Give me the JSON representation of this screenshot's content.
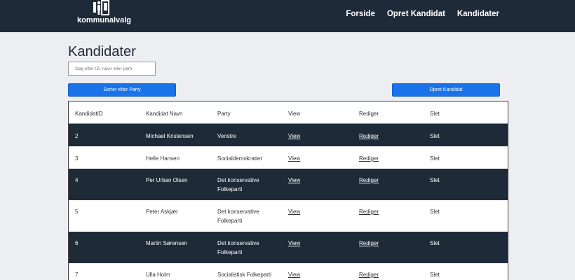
{
  "nav": {
    "logo_text": "kommunalvalg",
    "links": [
      "Forside",
      "Opret Kandidat",
      "Kandidater"
    ]
  },
  "page": {
    "title": "Kandidater",
    "search_placeholder": "Søg efter ID, navn eller parti",
    "sort_button": "Sorter efter Party",
    "create_button": "Opret Kandidat"
  },
  "table": {
    "headers": [
      "KandidatID",
      "Kandidat Navn",
      "Party",
      "View",
      "Rediger",
      "Slet"
    ],
    "rows": [
      {
        "id": "2",
        "name": "Michael Kristensen",
        "party": "Venstre",
        "view": "View",
        "edit": "Rediger",
        "del": "Slet"
      },
      {
        "id": "3",
        "name": "Helle Hansen",
        "party": "Socialdemokratiet",
        "view": "View",
        "edit": "Rediger",
        "del": "Slet"
      },
      {
        "id": "4",
        "name": "Per Urban Olsen",
        "party": "Det konservative Folkeparti",
        "view": "View",
        "edit": "Rediger",
        "del": "Slet"
      },
      {
        "id": "5",
        "name": "Peter Askjær",
        "party": "Det konservative Folkeparti",
        "view": "View",
        "edit": "Rediger",
        "del": "Slet"
      },
      {
        "id": "6",
        "name": "Martin Sørensen",
        "party": "Det konservative Folkeparti",
        "view": "View",
        "edit": "Rediger",
        "del": "Slet"
      },
      {
        "id": "7",
        "name": "Ulla Holm",
        "party": "Socialistisk Folkeparti",
        "view": "View",
        "edit": "Rediger",
        "del": "Slet"
      }
    ]
  },
  "colors": {
    "navbar": "#1e2a38",
    "button": "#1a73e8",
    "dark_row": "#1e2a38"
  }
}
